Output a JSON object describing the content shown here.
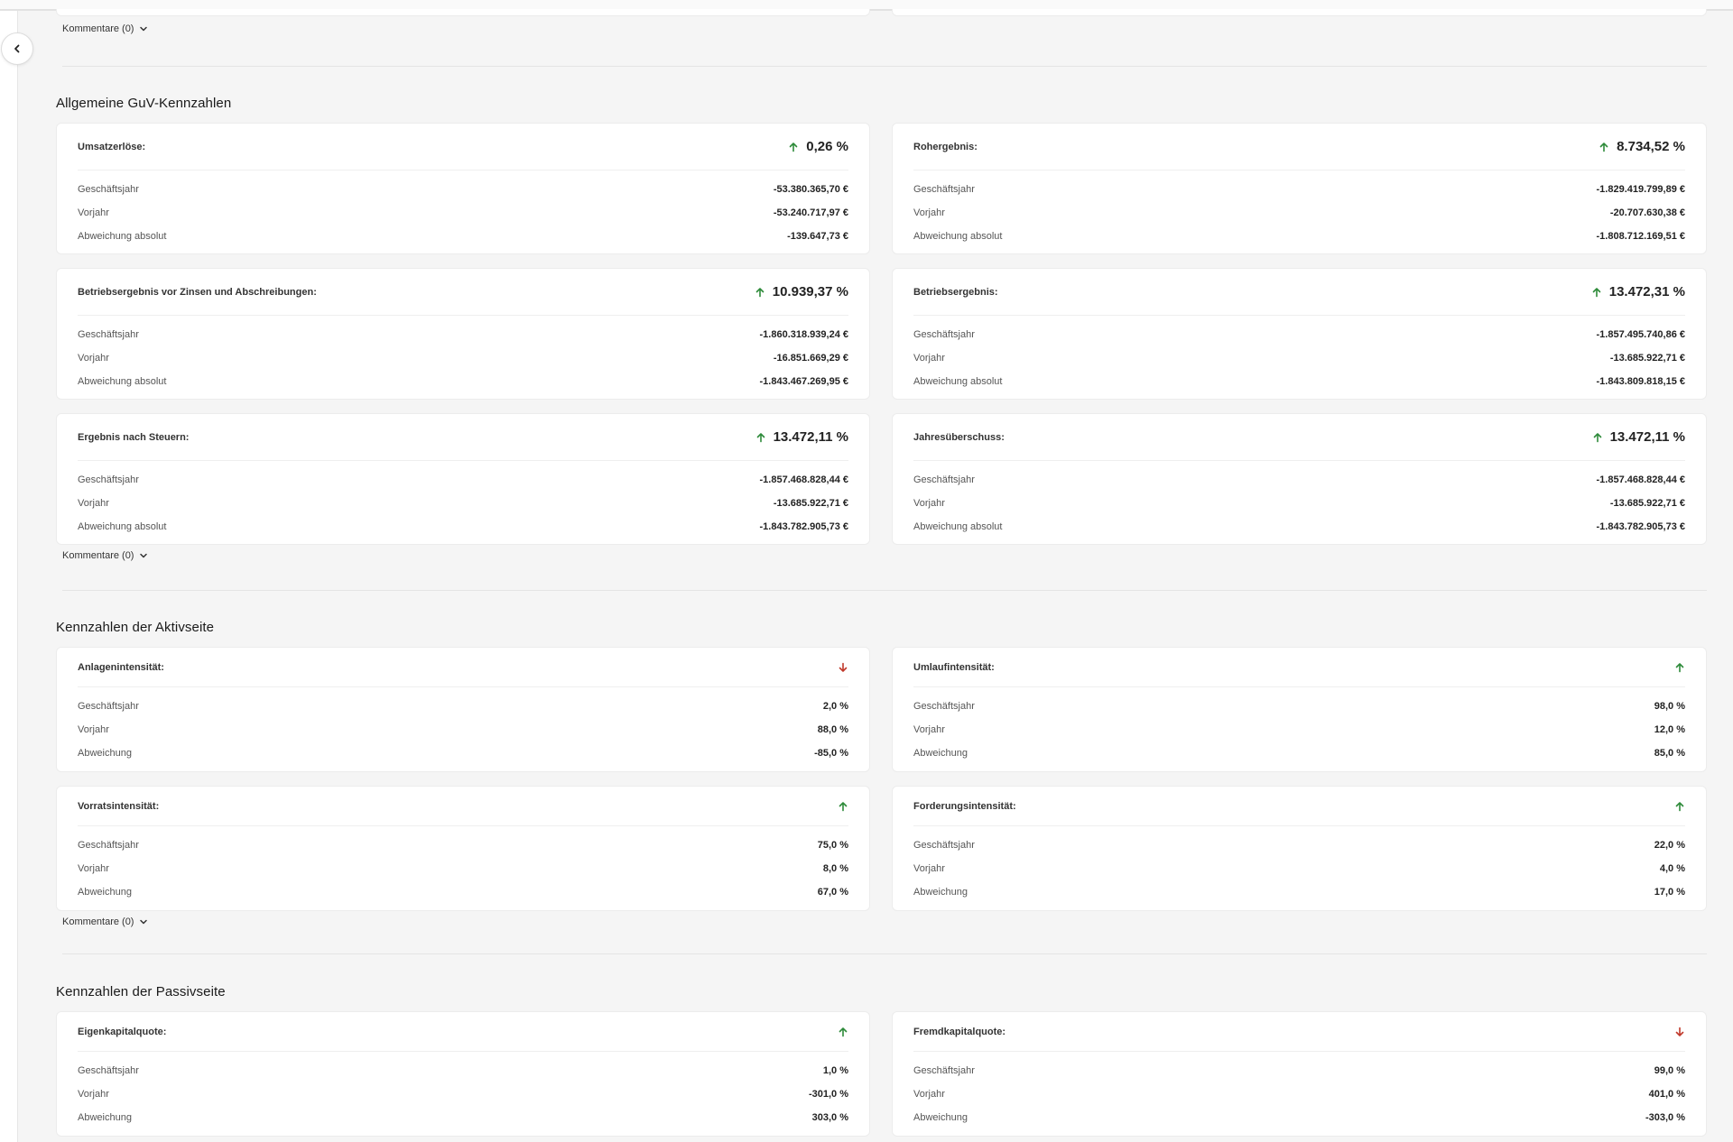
{
  "comments_label": "Kommentare (0)",
  "colors": {
    "up": "#2e8b3a",
    "down": "#c0392b"
  },
  "guv": {
    "title": "Allgemeine GuV-Kennzahlen",
    "cards": [
      {
        "title": "Umsatzerlöse:",
        "trend": "up",
        "kpi": "0,26 %",
        "rows": [
          {
            "label": "Geschäftsjahr",
            "value": "-53.380.365,70 €"
          },
          {
            "label": "Vorjahr",
            "value": "-53.240.717,97 €"
          },
          {
            "label": "Abweichung absolut",
            "value": "-139.647,73 €"
          }
        ]
      },
      {
        "title": "Rohergebnis:",
        "trend": "up",
        "kpi": "8.734,52 %",
        "rows": [
          {
            "label": "Geschäftsjahr",
            "value": "-1.829.419.799,89 €"
          },
          {
            "label": "Vorjahr",
            "value": "-20.707.630,38 €"
          },
          {
            "label": "Abweichung absolut",
            "value": "-1.808.712.169,51 €"
          }
        ]
      },
      {
        "title": "Betriebsergebnis vor Zinsen und Abschreibungen:",
        "trend": "up",
        "kpi": "10.939,37 %",
        "rows": [
          {
            "label": "Geschäftsjahr",
            "value": "-1.860.318.939,24 €"
          },
          {
            "label": "Vorjahr",
            "value": "-16.851.669,29 €"
          },
          {
            "label": "Abweichung absolut",
            "value": "-1.843.467.269,95 €"
          }
        ]
      },
      {
        "title": "Betriebsergebnis:",
        "trend": "up",
        "kpi": "13.472,31 %",
        "rows": [
          {
            "label": "Geschäftsjahr",
            "value": "-1.857.495.740,86 €"
          },
          {
            "label": "Vorjahr",
            "value": "-13.685.922,71 €"
          },
          {
            "label": "Abweichung absolut",
            "value": "-1.843.809.818,15 €"
          }
        ]
      },
      {
        "title": "Ergebnis nach Steuern:",
        "trend": "up",
        "kpi": "13.472,11 %",
        "rows": [
          {
            "label": "Geschäftsjahr",
            "value": "-1.857.468.828,44 €"
          },
          {
            "label": "Vorjahr",
            "value": "-13.685.922,71 €"
          },
          {
            "label": "Abweichung absolut",
            "value": "-1.843.782.905,73 €"
          }
        ]
      },
      {
        "title": "Jahresüberschuss:",
        "trend": "up",
        "kpi": "13.472,11 %",
        "rows": [
          {
            "label": "Geschäftsjahr",
            "value": "-1.857.468.828,44 €"
          },
          {
            "label": "Vorjahr",
            "value": "-13.685.922,71 €"
          },
          {
            "label": "Abweichung absolut",
            "value": "-1.843.782.905,73 €"
          }
        ]
      }
    ]
  },
  "aktiv": {
    "title": "Kennzahlen der Aktivseite",
    "cards": [
      {
        "title": "Anlagenintensität:",
        "trend": "down",
        "rows": [
          {
            "label": "Geschäftsjahr",
            "value": "2,0 %"
          },
          {
            "label": "Vorjahr",
            "value": "88,0 %"
          },
          {
            "label": "Abweichung",
            "value": "-85,0 %"
          }
        ]
      },
      {
        "title": "Umlaufintensität:",
        "trend": "up",
        "rows": [
          {
            "label": "Geschäftsjahr",
            "value": "98,0 %"
          },
          {
            "label": "Vorjahr",
            "value": "12,0 %"
          },
          {
            "label": "Abweichung",
            "value": "85,0 %"
          }
        ]
      },
      {
        "title": "Vorratsintensität:",
        "trend": "up",
        "rows": [
          {
            "label": "Geschäftsjahr",
            "value": "75,0 %"
          },
          {
            "label": "Vorjahr",
            "value": "8,0 %"
          },
          {
            "label": "Abweichung",
            "value": "67,0 %"
          }
        ]
      },
      {
        "title": "Forderungsintensität:",
        "trend": "up",
        "rows": [
          {
            "label": "Geschäftsjahr",
            "value": "22,0 %"
          },
          {
            "label": "Vorjahr",
            "value": "4,0 %"
          },
          {
            "label": "Abweichung",
            "value": "17,0 %"
          }
        ]
      }
    ]
  },
  "passiv": {
    "title": "Kennzahlen der Passivseite",
    "cards": [
      {
        "title": "Eigenkapitalquote:",
        "trend": "up",
        "rows": [
          {
            "label": "Geschäftsjahr",
            "value": "1,0 %"
          },
          {
            "label": "Vorjahr",
            "value": "-301,0 %"
          },
          {
            "label": "Abweichung",
            "value": "303,0 %"
          }
        ]
      },
      {
        "title": "Fremdkapitalquote:",
        "trend": "down",
        "rows": [
          {
            "label": "Geschäftsjahr",
            "value": "99,0 %"
          },
          {
            "label": "Vorjahr",
            "value": "401,0 %"
          },
          {
            "label": "Abweichung",
            "value": "-303,0 %"
          }
        ]
      }
    ]
  }
}
